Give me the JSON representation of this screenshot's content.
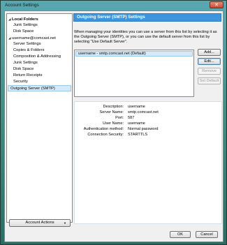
{
  "window": {
    "title": "Account Settings",
    "close_glyph": "✕"
  },
  "tree": {
    "items": [
      {
        "label": "Local Folders",
        "bold": true,
        "expanded": true,
        "indent": 0
      },
      {
        "label": "Junk Settings",
        "indent": 1
      },
      {
        "label": "Disk Space",
        "indent": 1
      },
      {
        "label": "username@comcast.net",
        "expanded": true,
        "indent": 0
      },
      {
        "label": "Server Settings",
        "indent": 1
      },
      {
        "label": "Copies & Folders",
        "indent": 1
      },
      {
        "label": "Composition & Addressing",
        "indent": 1
      },
      {
        "label": "Junk Settings",
        "indent": 1
      },
      {
        "label": "Disk Space",
        "indent": 1
      },
      {
        "label": "Return Receipts",
        "indent": 1
      },
      {
        "label": "Security",
        "indent": 1
      },
      {
        "label": "Outgoing Server (SMTP)",
        "indent": 0,
        "selected": true
      }
    ],
    "expanded_arrow": "◢",
    "account_actions_label": "Account Actions",
    "account_actions_arrow": "▼"
  },
  "panel": {
    "title": "Outgoing Server (SMTP) Settings",
    "description": "When managing your identities you can use a server from this list by selecting it as the Outgoing Server (SMTP), or you can use the default server from this list by selecting \"Use Default Server\".",
    "servers": [
      "username - smtp.comcast.net (Default)"
    ],
    "buttons": {
      "add": "Add...",
      "edit": "Edit...",
      "remove": "Remove",
      "set_default": "Set Default"
    },
    "details": {
      "description_label": "Description:",
      "description_value": "username",
      "server_name_label": "Server Name:",
      "server_name_value": "smtp.comcast.net",
      "port_label": "Port:",
      "port_value": "587",
      "user_name_label": "User Name:",
      "user_name_value": "username",
      "auth_label": "Authentication method:",
      "auth_value": "Normal password",
      "security_label": "Connection Security:",
      "security_value": "STARTTLS"
    }
  },
  "footer": {
    "ok": "OK",
    "cancel": "Cancel"
  }
}
